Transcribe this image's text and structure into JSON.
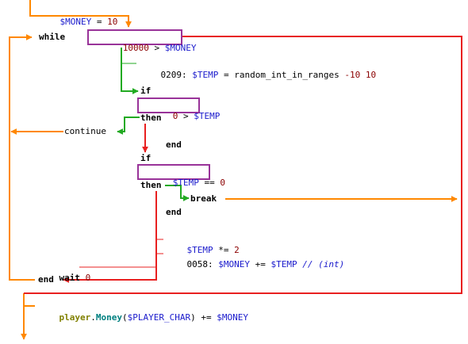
{
  "colors": {
    "orange": "#ff8800",
    "red": "#e82020",
    "green": "#22aa22",
    "purple": "#993399"
  },
  "code": {
    "init": {
      "var": "$MONEY",
      "op": " = ",
      "num": "10"
    },
    "while_kw": "while",
    "while_cond": {
      "num": "10000",
      "op": " > ",
      "var": "$MONEY"
    },
    "temp_line": {
      "prefix": "0209: ",
      "var": "$TEMP",
      "op": " = random_int_in_ranges ",
      "num1": "-10",
      "sp": " ",
      "num2": "10"
    },
    "if1": "if",
    "if1_cond": {
      "num": "0",
      "op": " > ",
      "var": "$TEMP"
    },
    "then1": "then",
    "continue": "continue",
    "end1": "end",
    "if2": "if",
    "if2_cond": {
      "var": "$TEMP",
      "op": " == ",
      "num": "0"
    },
    "then2": "then",
    "break": "break",
    "end2": "end",
    "mult_line": {
      "var": "$TEMP",
      "op": " *= ",
      "num": "2"
    },
    "add_line": {
      "prefix": "0058: ",
      "var1": "$MONEY",
      "op": " += ",
      "var2": "$TEMP",
      "comment": " // (int)"
    },
    "wait": {
      "kw": "wait",
      "sp": " ",
      "num": "0"
    },
    "end_while": "end",
    "final_line": {
      "obj": "player",
      "dot": ".",
      "meth": "Money",
      "paren_open": "(",
      "var1": "$PLAYER_CHAR",
      "paren_close": ")",
      "op": " += ",
      "var2": "$MONEY"
    }
  }
}
